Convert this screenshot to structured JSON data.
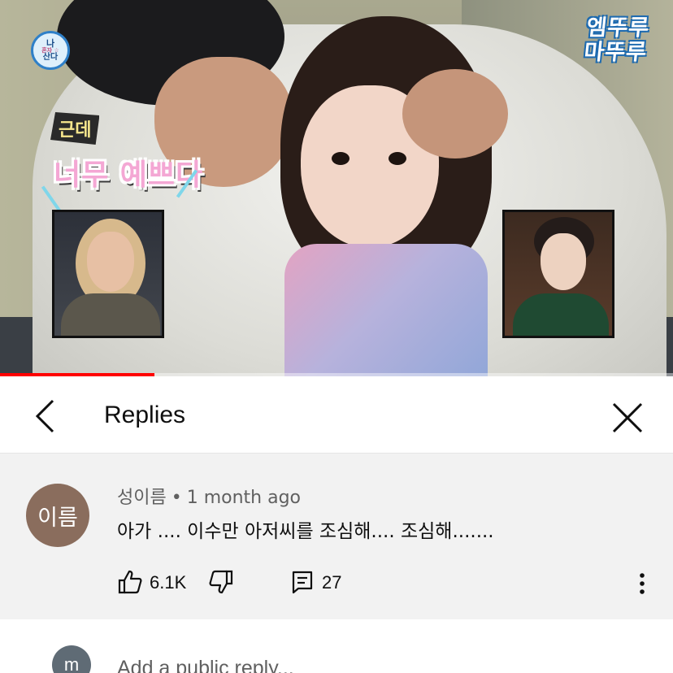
{
  "video": {
    "show_logo_lines": [
      "나",
      "혼자 ☆",
      "산다"
    ],
    "brand_lines": [
      "엠뚜루",
      "마뚜루"
    ],
    "caption_small": "근데",
    "caption_big": "너무 예쁘다",
    "progress_fraction": 0.23
  },
  "header": {
    "back_icon": "chevron-left-icon",
    "title": "Replies",
    "close_icon": "close-icon"
  },
  "comment": {
    "avatar_text": "이름",
    "author": "성이름",
    "separator": "•",
    "time": "1 month ago",
    "text": "아가 .... 이수만 아저씨를 조심해.... 조심해.......",
    "like_icon": "thumbs-up-icon",
    "likes": "6.1K",
    "dislike_icon": "thumbs-down-icon",
    "reply_icon": "reply-icon",
    "replies": "27",
    "more_icon": "more-vertical-icon"
  },
  "reply_box": {
    "avatar_text": "m",
    "placeholder": "Add a public reply..."
  },
  "colors": {
    "progress": "#ff0000",
    "comment_bg": "#f2f2f2",
    "avatar_bg": "#8a6d5d"
  }
}
